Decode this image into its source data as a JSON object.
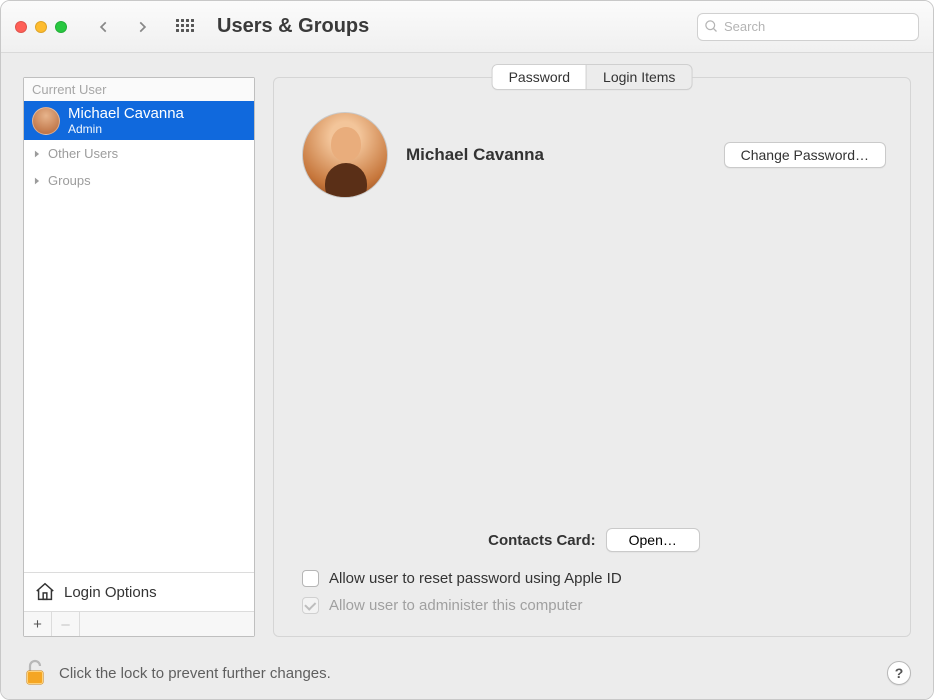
{
  "window": {
    "title": "Users & Groups",
    "search_placeholder": "Search"
  },
  "sidebar": {
    "header": "Current User",
    "current_user": {
      "name": "Michael Cavanna",
      "role": "Admin"
    },
    "groups": [
      {
        "label": "Other Users"
      },
      {
        "label": "Groups"
      }
    ],
    "login_options": "Login Options",
    "add": "+",
    "remove": "–"
  },
  "tabs": {
    "password": "Password",
    "login_items": "Login Items"
  },
  "panel": {
    "user_name": "Michael Cavanna",
    "change_password": "Change Password…",
    "contacts_label": "Contacts Card:",
    "open": "Open…",
    "allow_reset": "Allow user to reset password using Apple ID",
    "allow_admin": "Allow user to administer this computer"
  },
  "footer": {
    "lock_text": "Click the lock to prevent further changes.",
    "help": "?"
  }
}
